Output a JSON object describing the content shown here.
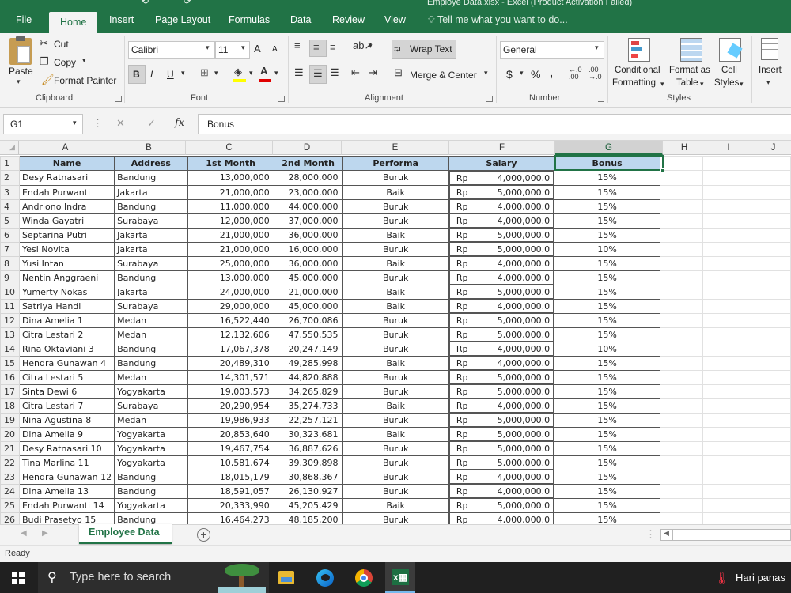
{
  "window": {
    "title": "Employe Data.xlsx - Excel (Product Activation Failed)"
  },
  "tabs": [
    {
      "label": "File"
    },
    {
      "label": "Home"
    },
    {
      "label": "Insert"
    },
    {
      "label": "Page Layout"
    },
    {
      "label": "Formulas"
    },
    {
      "label": "Data"
    },
    {
      "label": "Review"
    },
    {
      "label": "View"
    }
  ],
  "tell_me": "Tell me what you want to do...",
  "ribbon": {
    "clipboard": {
      "paste": "Paste",
      "cut": "Cut",
      "copy": "Copy",
      "format_painter": "Format Painter",
      "label": "Clipboard"
    },
    "font": {
      "name": "Calibri",
      "size": "11",
      "bold": "B",
      "italic": "I",
      "underline": "U",
      "grow": "A",
      "shrink": "A",
      "label": "Font"
    },
    "alignment": {
      "wrap_text": "Wrap Text",
      "merge_center": "Merge & Center",
      "label": "Alignment"
    },
    "number": {
      "format": "General",
      "currency": "$",
      "percent": "%",
      "comma": ",",
      "label": "Number"
    },
    "styles": {
      "conditional": "Conditional",
      "formatting": "Formatting",
      "format_as": "Format as",
      "table": "Table",
      "cell": "Cell",
      "cell_styles": "Styles",
      "label": "Styles"
    },
    "cells": {
      "insert": "Insert"
    }
  },
  "formula_bar": {
    "name_box": "G1",
    "cancel": "✕",
    "enter": "✓",
    "fx": "fx",
    "content": "Bonus"
  },
  "grid": {
    "columns": [
      "A",
      "B",
      "C",
      "D",
      "E",
      "F",
      "G",
      "H",
      "I",
      "J"
    ],
    "headers": [
      "Name",
      "Address",
      "1st Month",
      "2nd Month",
      "Performa",
      "Salary",
      "Bonus"
    ],
    "rows": [
      {
        "n": "2",
        "name": "Desy Ratnasari",
        "address": "Bandung",
        "m1": "13,000,000",
        "m2": "28,000,000",
        "perf": "Buruk",
        "cur": "Rp",
        "salary": "4,000,000.0",
        "bonus": "15%"
      },
      {
        "n": "3",
        "name": "Endah Purwanti",
        "address": "Jakarta",
        "m1": "21,000,000",
        "m2": "23,000,000",
        "perf": "Baik",
        "cur": "Rp",
        "salary": "5,000,000.0",
        "bonus": "15%"
      },
      {
        "n": "4",
        "name": "Andriono Indra",
        "address": "Bandung",
        "m1": "11,000,000",
        "m2": "44,000,000",
        "perf": "Buruk",
        "cur": "Rp",
        "salary": "4,000,000.0",
        "bonus": "15%"
      },
      {
        "n": "5",
        "name": "Winda Gayatri",
        "address": "Surabaya",
        "m1": "12,000,000",
        "m2": "37,000,000",
        "perf": "Buruk",
        "cur": "Rp",
        "salary": "4,000,000.0",
        "bonus": "15%"
      },
      {
        "n": "6",
        "name": "Septarina Putri",
        "address": "Jakarta",
        "m1": "21,000,000",
        "m2": "36,000,000",
        "perf": "Baik",
        "cur": "Rp",
        "salary": "5,000,000.0",
        "bonus": "15%"
      },
      {
        "n": "7",
        "name": "Yesi Novita",
        "address": "Jakarta",
        "m1": "21,000,000",
        "m2": "16,000,000",
        "perf": "Buruk",
        "cur": "Rp",
        "salary": "5,000,000.0",
        "bonus": "10%"
      },
      {
        "n": "8",
        "name": "Yusi Intan",
        "address": "Surabaya",
        "m1": "25,000,000",
        "m2": "36,000,000",
        "perf": "Baik",
        "cur": "Rp",
        "salary": "4,000,000.0",
        "bonus": "15%"
      },
      {
        "n": "9",
        "name": "Nentin Anggraeni",
        "address": "Bandung",
        "m1": "13,000,000",
        "m2": "45,000,000",
        "perf": "Buruk",
        "cur": "Rp",
        "salary": "4,000,000.0",
        "bonus": "15%"
      },
      {
        "n": "10",
        "name": "Yumerty Nokas",
        "address": "Jakarta",
        "m1": "24,000,000",
        "m2": "21,000,000",
        "perf": "Baik",
        "cur": "Rp",
        "salary": "5,000,000.0",
        "bonus": "15%"
      },
      {
        "n": "11",
        "name": "Satriya Handi",
        "address": "Surabaya",
        "m1": "29,000,000",
        "m2": "45,000,000",
        "perf": "Baik",
        "cur": "Rp",
        "salary": "4,000,000.0",
        "bonus": "15%"
      },
      {
        "n": "12",
        "name": "Dina Amelia 1",
        "address": "Medan",
        "m1": "16,522,440",
        "m2": "26,700,086",
        "perf": "Buruk",
        "cur": "Rp",
        "salary": "5,000,000.0",
        "bonus": "15%"
      },
      {
        "n": "13",
        "name": "Citra Lestari 2",
        "address": "Medan",
        "m1": "12,132,606",
        "m2": "47,550,535",
        "perf": "Buruk",
        "cur": "Rp",
        "salary": "5,000,000.0",
        "bonus": "15%"
      },
      {
        "n": "14",
        "name": "Rina Oktaviani 3",
        "address": "Bandung",
        "m1": "17,067,378",
        "m2": "20,247,149",
        "perf": "Buruk",
        "cur": "Rp",
        "salary": "4,000,000.0",
        "bonus": "10%"
      },
      {
        "n": "15",
        "name": "Hendra Gunawan 4",
        "address": "Bandung",
        "m1": "20,489,310",
        "m2": "49,285,998",
        "perf": "Baik",
        "cur": "Rp",
        "salary": "4,000,000.0",
        "bonus": "15%"
      },
      {
        "n": "16",
        "name": "Citra Lestari 5",
        "address": "Medan",
        "m1": "14,301,571",
        "m2": "44,820,888",
        "perf": "Buruk",
        "cur": "Rp",
        "salary": "5,000,000.0",
        "bonus": "15%"
      },
      {
        "n": "17",
        "name": "Sinta Dewi 6",
        "address": "Yogyakarta",
        "m1": "19,003,573",
        "m2": "34,265,829",
        "perf": "Buruk",
        "cur": "Rp",
        "salary": "5,000,000.0",
        "bonus": "15%"
      },
      {
        "n": "18",
        "name": "Citra Lestari 7",
        "address": "Surabaya",
        "m1": "20,290,954",
        "m2": "35,274,733",
        "perf": "Baik",
        "cur": "Rp",
        "salary": "4,000,000.0",
        "bonus": "15%"
      },
      {
        "n": "19",
        "name": "Nina Agustina 8",
        "address": "Medan",
        "m1": "19,986,933",
        "m2": "22,257,121",
        "perf": "Buruk",
        "cur": "Rp",
        "salary": "5,000,000.0",
        "bonus": "15%"
      },
      {
        "n": "20",
        "name": "Dina Amelia 9",
        "address": "Yogyakarta",
        "m1": "20,853,640",
        "m2": "30,323,681",
        "perf": "Baik",
        "cur": "Rp",
        "salary": "5,000,000.0",
        "bonus": "15%"
      },
      {
        "n": "21",
        "name": "Desy Ratnasari 10",
        "address": "Yogyakarta",
        "m1": "19,467,754",
        "m2": "36,887,626",
        "perf": "Buruk",
        "cur": "Rp",
        "salary": "5,000,000.0",
        "bonus": "15%"
      },
      {
        "n": "22",
        "name": "Tina Marlina 11",
        "address": "Yogyakarta",
        "m1": "10,581,674",
        "m2": "39,309,898",
        "perf": "Buruk",
        "cur": "Rp",
        "salary": "5,000,000.0",
        "bonus": "15%"
      },
      {
        "n": "23",
        "name": "Hendra Gunawan 12",
        "address": "Bandung",
        "m1": "18,015,179",
        "m2": "30,868,367",
        "perf": "Buruk",
        "cur": "Rp",
        "salary": "4,000,000.0",
        "bonus": "15%"
      },
      {
        "n": "24",
        "name": "Dina Amelia 13",
        "address": "Bandung",
        "m1": "18,591,057",
        "m2": "26,130,927",
        "perf": "Buruk",
        "cur": "Rp",
        "salary": "4,000,000.0",
        "bonus": "15%"
      },
      {
        "n": "25",
        "name": "Endah Purwanti 14",
        "address": "Yogyakarta",
        "m1": "20,333,990",
        "m2": "45,205,429",
        "perf": "Baik",
        "cur": "Rp",
        "salary": "5,000,000.0",
        "bonus": "15%"
      },
      {
        "n": "26",
        "name": "Budi Prasetyo 15",
        "address": "Bandung",
        "m1": "16,464,273",
        "m2": "48,185,200",
        "perf": "Buruk",
        "cur": "Rp",
        "salary": "4,000,000.0",
        "bonus": "15%"
      }
    ]
  },
  "sheet_tabs": {
    "active": "Employee Data",
    "add": "+"
  },
  "status": {
    "ready": "Ready"
  },
  "taskbar": {
    "search_placeholder": "Type here to search",
    "weather": "Hari panas"
  },
  "colors": {
    "excel_green": "#217346",
    "header_fill": "#bdd7ee",
    "taskbar": "#202020"
  }
}
